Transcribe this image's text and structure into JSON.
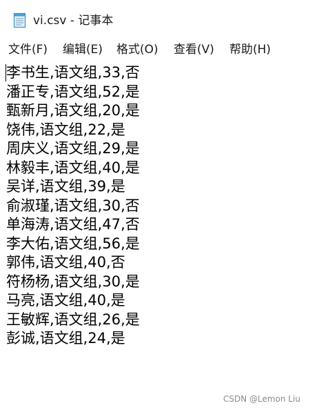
{
  "window": {
    "title": "vi.csv - 记事本",
    "app_icon": "notepad-icon"
  },
  "menu": [
    {
      "label": "文件(F)"
    },
    {
      "label": "编辑(E)"
    },
    {
      "label": "格式(O)"
    },
    {
      "label": "查看(V)"
    },
    {
      "label": "帮助(H)"
    }
  ],
  "document": {
    "lines": [
      "李书生,语文组,33,否",
      "潘正专,语文组,52,是",
      "甄新月,语文组,20,是",
      "饶伟,语文组,22,是",
      "周庆义,语文组,29,是",
      "林毅丰,语文组,40,是",
      "吴详,语文组,39,是",
      "俞淑瑾,语文组,30,否",
      "单海涛,语文组,47,否",
      "李大佑,语文组,56,是",
      "郭伟,语文组,40,否",
      "符杨杨,语文组,30,是",
      "马亮,语文组,40,是",
      "王敏辉,语文组,26,是",
      "彭诚,语文组,24,是"
    ]
  },
  "watermark": "CSDN @Lemon Liu"
}
